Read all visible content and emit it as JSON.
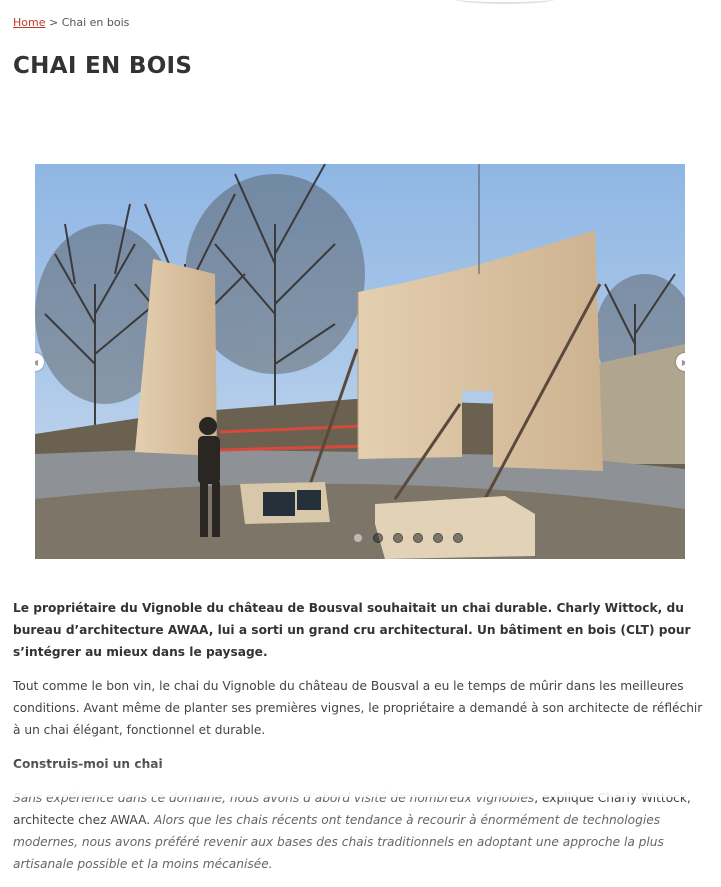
{
  "breadcrumb": {
    "home": "Home",
    "separator": ">",
    "current": "Chai en bois"
  },
  "page": {
    "title": "CHAI EN BOIS"
  },
  "slider": {
    "prev_icon": "chevron-left-icon",
    "next_icon": "chevron-right-icon",
    "slide_count": 6,
    "active_index": 0
  },
  "article": {
    "lead": "Le propriétaire du Vignoble du château de Bousval souhaitait un chai durable. Charly Wittock, du bureau d’architecture AWAA, lui a sorti un grand cru architectural. Un bâtiment en bois (CLT) pour s’intégrer au mieux dans le paysage.",
    "paragraph1": "Tout comme le bon vin, le chai du Vignoble du château de Bousval a eu le temps de mûrir dans les meilleures conditions. Avant même de planter ses premières vignes, le propriétaire a demandé à son architecte de réfléchir à un chai élégant, fonctionnel et durable.",
    "subheading": "Construis-moi un chai",
    "quote_part1": "Sans expérience dans ce domaine, nous avons d’abord visité de nombreux vignobles",
    "quote_attribution": ", explique Charly Wittock, architecte chez AWAA. ",
    "quote_part2": "Alors que les chais récents ont tendance à recourir à énormément de technologies modernes, nous avons préféré revenir aux bases des chais traditionnels en adoptant une approche la plus artisanale possible et la moins mécanisée."
  }
}
